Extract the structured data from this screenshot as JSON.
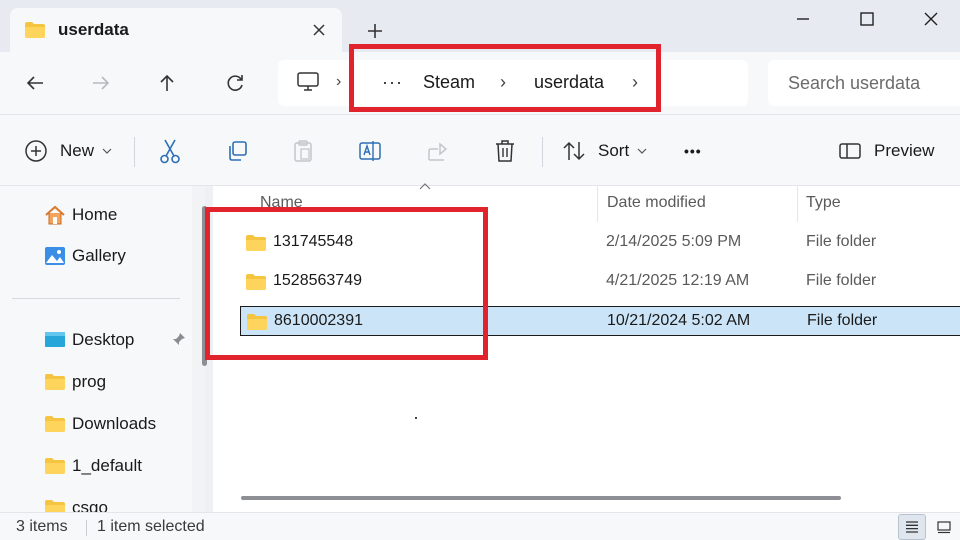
{
  "window": {
    "tab_title": "userdata"
  },
  "address_bar": {
    "more": "···",
    "crumbs": [
      "Steam",
      "userdata"
    ]
  },
  "search": {
    "placeholder": "Search userdata"
  },
  "commands": {
    "new_label": "New",
    "sort_label": "Sort",
    "more_label": "•••",
    "preview_label": "Preview"
  },
  "sidebar": {
    "items": [
      {
        "label": "Home",
        "icon": "home-icon"
      },
      {
        "label": "Gallery",
        "icon": "gallery-icon"
      },
      {
        "label": "Desktop",
        "icon": "desktop-icon"
      },
      {
        "label": "prog",
        "icon": "folder-icon"
      },
      {
        "label": "Downloads",
        "icon": "folder-icon"
      },
      {
        "label": "1_default",
        "icon": "folder-icon"
      },
      {
        "label": "csgo",
        "icon": "folder-icon"
      }
    ]
  },
  "file_list": {
    "columns": [
      "Name",
      "Date modified",
      "Type"
    ],
    "rows": [
      {
        "name": "131745548",
        "date": "2/14/2025 5:09 PM",
        "type": "File folder",
        "selected": false
      },
      {
        "name": "1528563749",
        "date": "4/21/2025 12:19 AM",
        "type": "File folder",
        "selected": false
      },
      {
        "name": "8610002391",
        "date": "10/21/2024 5:02 AM",
        "type": "File folder",
        "selected": true
      }
    ]
  },
  "status": {
    "item_count": "3 items",
    "selection": "1 item selected"
  },
  "colors": {
    "annotation": "#e0232c",
    "folder": "#f5c542",
    "selection": "#cce4f7"
  }
}
